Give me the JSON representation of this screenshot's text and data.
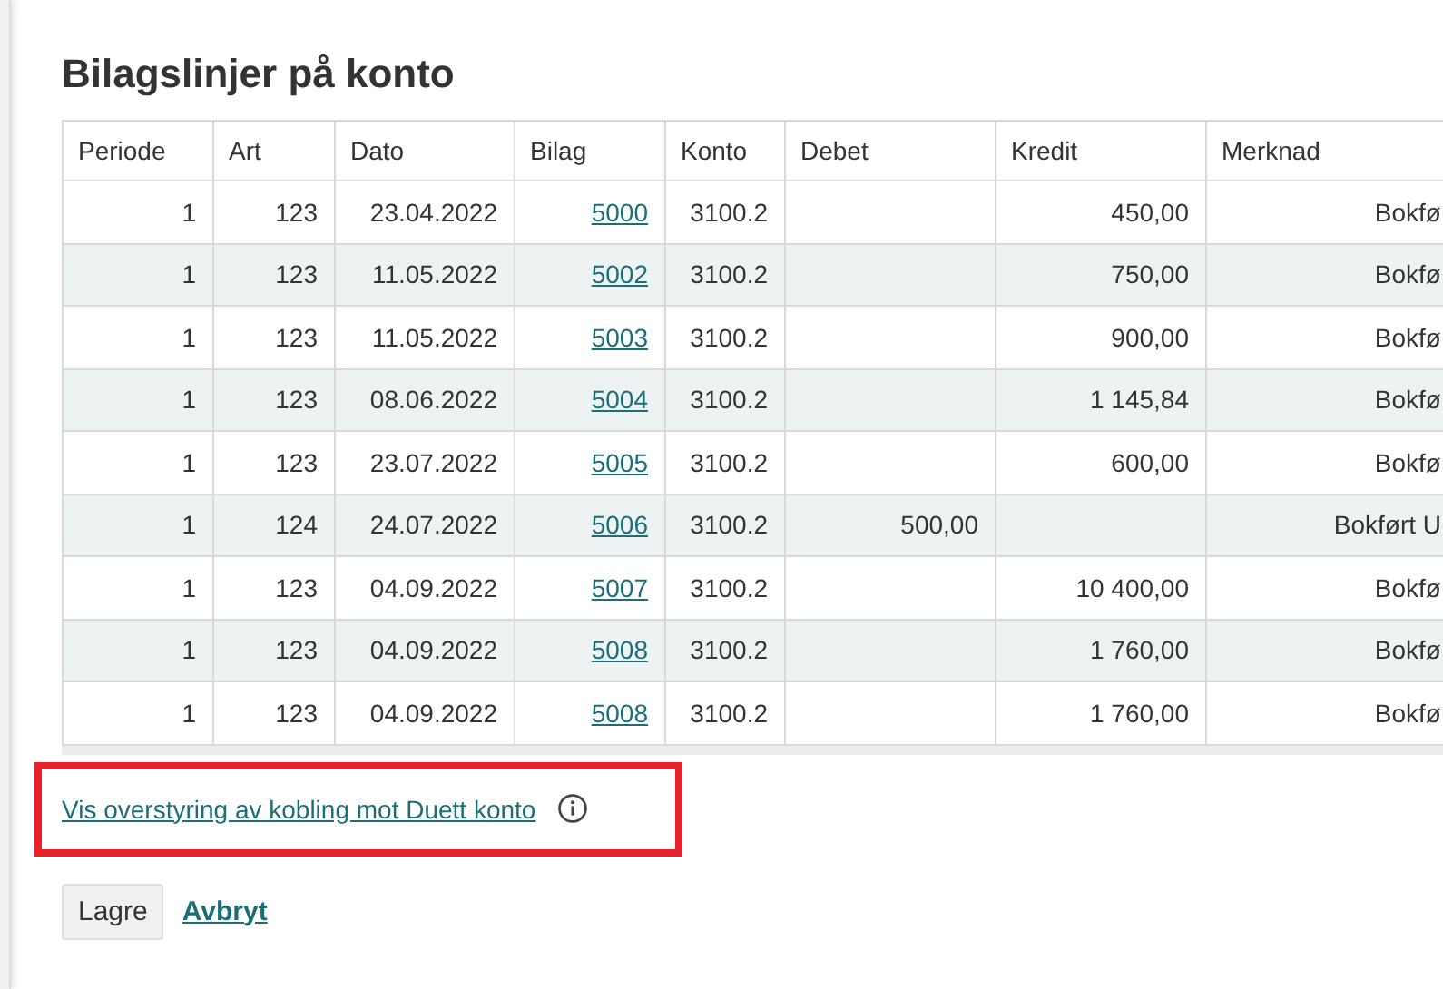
{
  "dialog": {
    "title": "Bilagslinjer på konto"
  },
  "table": {
    "columns": [
      "Periode",
      "Art",
      "Dato",
      "Bilag",
      "Konto",
      "Debet",
      "Kredit",
      "Merknad"
    ],
    "rows": [
      {
        "periode": "1",
        "art": "123",
        "dato": "23.04.2022",
        "bilag": "5000",
        "konto": "3100.2",
        "debet": "",
        "kredit": "450,00",
        "merknad": "Bokfø"
      },
      {
        "periode": "1",
        "art": "123",
        "dato": "11.05.2022",
        "bilag": "5002",
        "konto": "3100.2",
        "debet": "",
        "kredit": "750,00",
        "merknad": "Bokfø"
      },
      {
        "periode": "1",
        "art": "123",
        "dato": "11.05.2022",
        "bilag": "5003",
        "konto": "3100.2",
        "debet": "",
        "kredit": "900,00",
        "merknad": "Bokfø"
      },
      {
        "periode": "1",
        "art": "123",
        "dato": "08.06.2022",
        "bilag": "5004",
        "konto": "3100.2",
        "debet": "",
        "kredit": "1 145,84",
        "merknad": "Bokfø"
      },
      {
        "periode": "1",
        "art": "123",
        "dato": "23.07.2022",
        "bilag": "5005",
        "konto": "3100.2",
        "debet": "",
        "kredit": "600,00",
        "merknad": "Bokfø"
      },
      {
        "periode": "1",
        "art": "124",
        "dato": "24.07.2022",
        "bilag": "5006",
        "konto": "3100.2",
        "debet": "500,00",
        "kredit": "",
        "merknad": "Bokført U"
      },
      {
        "periode": "1",
        "art": "123",
        "dato": "04.09.2022",
        "bilag": "5007",
        "konto": "3100.2",
        "debet": "",
        "kredit": "10 400,00",
        "merknad": "Bokfø"
      },
      {
        "periode": "1",
        "art": "123",
        "dato": "04.09.2022",
        "bilag": "5008",
        "konto": "3100.2",
        "debet": "",
        "kredit": "1 760,00",
        "merknad": "Bokfø"
      },
      {
        "periode": "1",
        "art": "123",
        "dato": "04.09.2022",
        "bilag": "5008",
        "konto": "3100.2",
        "debet": "",
        "kredit": "1 760,00",
        "merknad": "Bokfø"
      }
    ]
  },
  "override_link": "Vis overstyring av kobling mot Duett konto",
  "buttons": {
    "save": "Lagre",
    "cancel": "Avbryt"
  }
}
